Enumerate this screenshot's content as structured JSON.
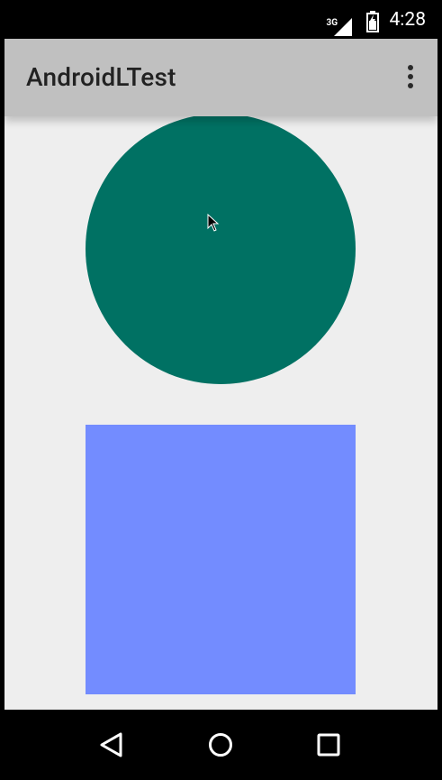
{
  "status_bar": {
    "network_type": "3G",
    "time": "4:28",
    "icons": [
      "signal-icon",
      "battery-icon"
    ]
  },
  "app_bar": {
    "title": "AndroidLTest",
    "menu_icon": "overflow-menu-icon"
  },
  "content": {
    "circle_color": "#007163",
    "square_color": "#738cff",
    "background_color": "#eeeeee"
  },
  "nav_bar": {
    "icons": [
      "back-icon",
      "home-icon",
      "recents-icon"
    ]
  },
  "colors": {
    "app_bar": "#c0c0c0",
    "system_bars": "#000000"
  }
}
